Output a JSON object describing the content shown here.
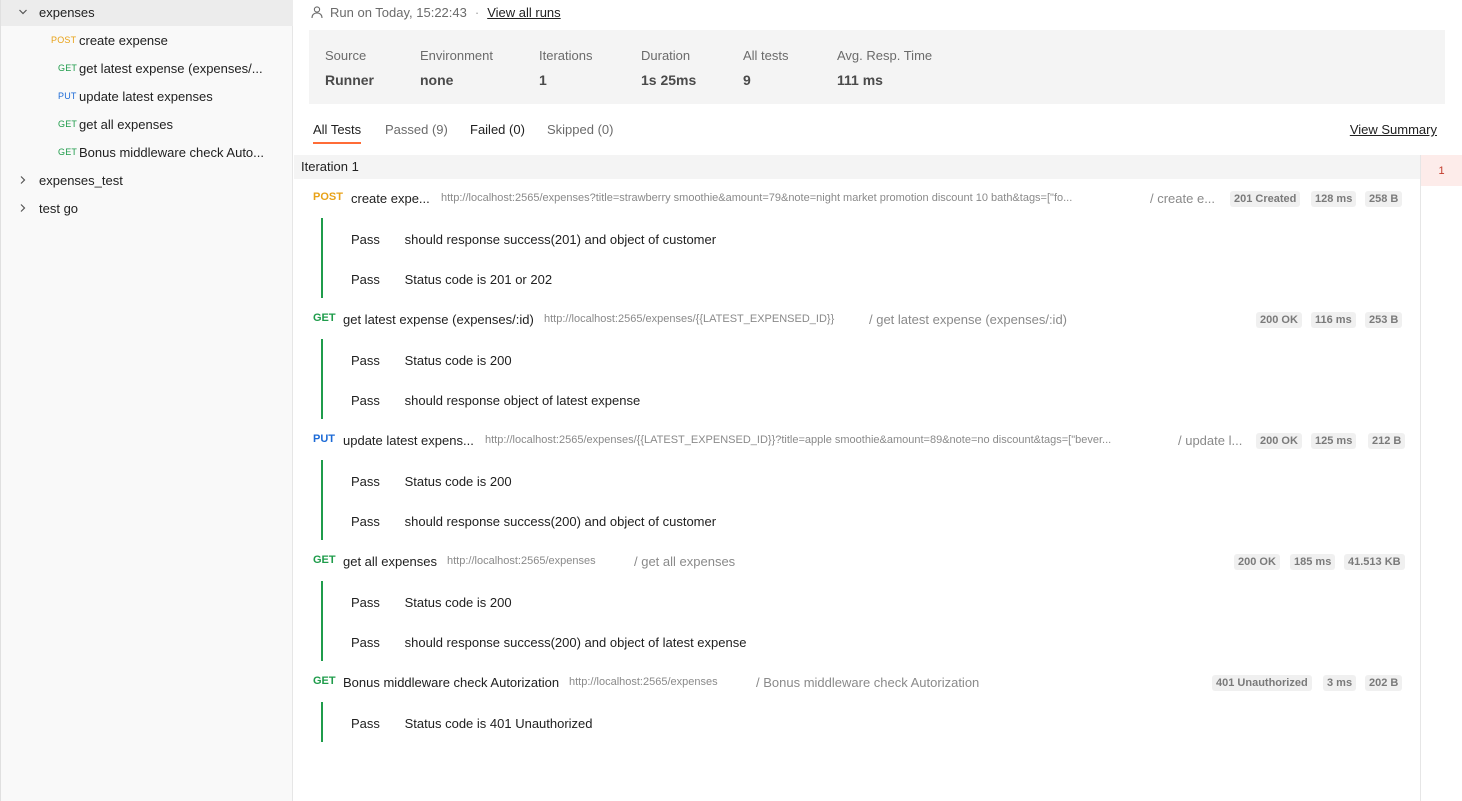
{
  "sidebar": {
    "folders": [
      {
        "label": "expenses",
        "expanded": true
      },
      {
        "label": "expenses_test",
        "expanded": false
      },
      {
        "label": "test go",
        "expanded": false
      }
    ],
    "requests": [
      {
        "method": "POST",
        "label": "create expense"
      },
      {
        "method": "GET",
        "label": "get latest expense (expenses/..."
      },
      {
        "method": "PUT",
        "label": "update latest expenses"
      },
      {
        "method": "GET",
        "label": "get all expenses"
      },
      {
        "method": "GET",
        "label": "Bonus middleware check Auto..."
      }
    ]
  },
  "run": {
    "run_on": "Run on Today, 15:22:43",
    "separator": "·",
    "view_all": "View all runs"
  },
  "summary": {
    "source": {
      "label": "Source",
      "value": "Runner"
    },
    "environment": {
      "label": "Environment",
      "value": "none"
    },
    "iterations": {
      "label": "Iterations",
      "value": "1"
    },
    "duration": {
      "label": "Duration",
      "value": "1s 25ms"
    },
    "all_tests": {
      "label": "All tests",
      "value": "9"
    },
    "avg_resp": {
      "label": "Avg. Resp. Time",
      "value": "111 ms"
    }
  },
  "tabs": {
    "all": "All Tests",
    "passed": "Passed (9)",
    "failed": "Failed (0)",
    "skipped": "Skipped (0)",
    "view_summary": "View Summary"
  },
  "iteration": {
    "label": "Iteration 1",
    "badge": "1"
  },
  "results": [
    {
      "method": "POST",
      "name": "create expe...",
      "url": "http://localhost:2565/expenses?title=strawberry smoothie&amount=79&note=night market promotion discount 10 bath&tags=[\"fo...",
      "path": "/ create e...",
      "status": "201 Created",
      "time": "128 ms",
      "size": "258 B",
      "tests": [
        {
          "result": "Pass",
          "name": "should response success(201) and object of customer"
        },
        {
          "result": "Pass",
          "name": "Status code is 201 or 202"
        }
      ]
    },
    {
      "method": "GET",
      "name": "get latest expense (expenses/:id)",
      "url": "http://localhost:2565/expenses/{{LATEST_EXPENSED_ID}}",
      "path": "/ get latest expense (expenses/:id)",
      "status": "200 OK",
      "time": "116 ms",
      "size": "253 B",
      "tests": [
        {
          "result": "Pass",
          "name": "Status code is 200"
        },
        {
          "result": "Pass",
          "name": "should response object of latest expense"
        }
      ]
    },
    {
      "method": "PUT",
      "name": "update latest expens...",
      "url": "http://localhost:2565/expenses/{{LATEST_EXPENSED_ID}}?title=apple smoothie&amount=89&note=no discount&tags=[\"bever...",
      "path": "/ update l...",
      "status": "200 OK",
      "time": "125 ms",
      "size": "212 B",
      "tests": [
        {
          "result": "Pass",
          "name": "Status code is 200"
        },
        {
          "result": "Pass",
          "name": "should response success(200) and object of customer"
        }
      ]
    },
    {
      "method": "GET",
      "name": "get all expenses",
      "url": "http://localhost:2565/expenses",
      "path": "/ get all expenses",
      "status": "200 OK",
      "time": "185 ms",
      "size": "41.513 KB",
      "tests": [
        {
          "result": "Pass",
          "name": "Status code is 200"
        },
        {
          "result": "Pass",
          "name": "should response success(200) and object of latest expense"
        }
      ]
    },
    {
      "method": "GET",
      "name": "Bonus middleware check Autorization",
      "url": "http://localhost:2565/expenses",
      "path": "/ Bonus middleware check Autorization",
      "status": "401 Unauthorized",
      "time": "3 ms",
      "size": "202 B",
      "tests": [
        {
          "result": "Pass",
          "name": "Status code is 401 Unauthorized"
        }
      ]
    }
  ],
  "colors": {
    "post": "#e8a218",
    "get": "#1f9c4b",
    "put": "#1c6ad6",
    "accent": "#ff6c37",
    "pass_bar": "#1f9c4b"
  },
  "icons": {
    "chevron_down": "chevron-down-icon",
    "chevron_right": "chevron-right-icon",
    "user": "user-icon"
  }
}
